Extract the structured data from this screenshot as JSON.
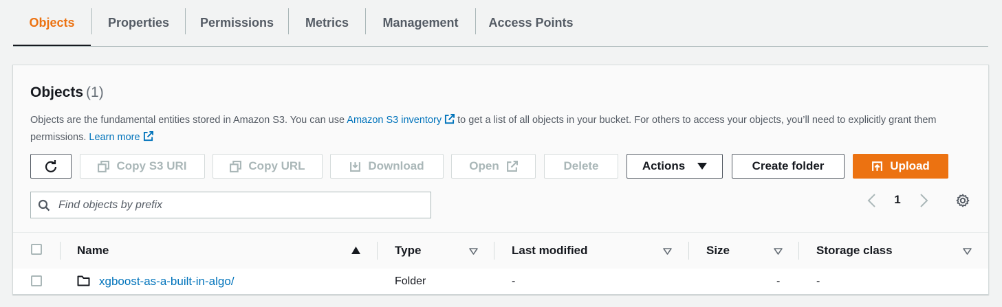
{
  "tabs": [
    {
      "label": "Objects",
      "active": true
    },
    {
      "label": "Properties"
    },
    {
      "label": "Permissions"
    },
    {
      "label": "Metrics"
    },
    {
      "label": "Management"
    },
    {
      "label": "Access Points"
    }
  ],
  "panel": {
    "title": "Objects",
    "count": "(1)",
    "desc_part1": "Objects are the fundamental entities stored in Amazon S3. You can use ",
    "desc_link1": "Amazon S3 inventory",
    "desc_part2": " to get a list of all objects in your bucket. For others to access your objects, you’ll need to explicitly grant them permissions. ",
    "desc_link2": "Learn more"
  },
  "toolbar": {
    "refresh_icon": "refresh-icon",
    "copy_s3_uri": "Copy S3 URI",
    "copy_url": "Copy URL",
    "download": "Download",
    "open": "Open",
    "delete": "Delete",
    "actions": "Actions",
    "create_folder": "Create folder",
    "upload": "Upload"
  },
  "search": {
    "placeholder": "Find objects by prefix"
  },
  "pagination": {
    "current_page": "1"
  },
  "table": {
    "columns": [
      "Name",
      "Type",
      "Last modified",
      "Size",
      "Storage class"
    ],
    "rows": [
      {
        "name": "xgboost-as-a-built-in-algo/",
        "type": "Folder",
        "last_modified": "-",
        "size": "-",
        "storage_class": "-"
      }
    ]
  },
  "colors": {
    "accent": "#ec7211",
    "link": "#0073bb",
    "text": "#16191f",
    "disabled": "#aab7b8"
  }
}
